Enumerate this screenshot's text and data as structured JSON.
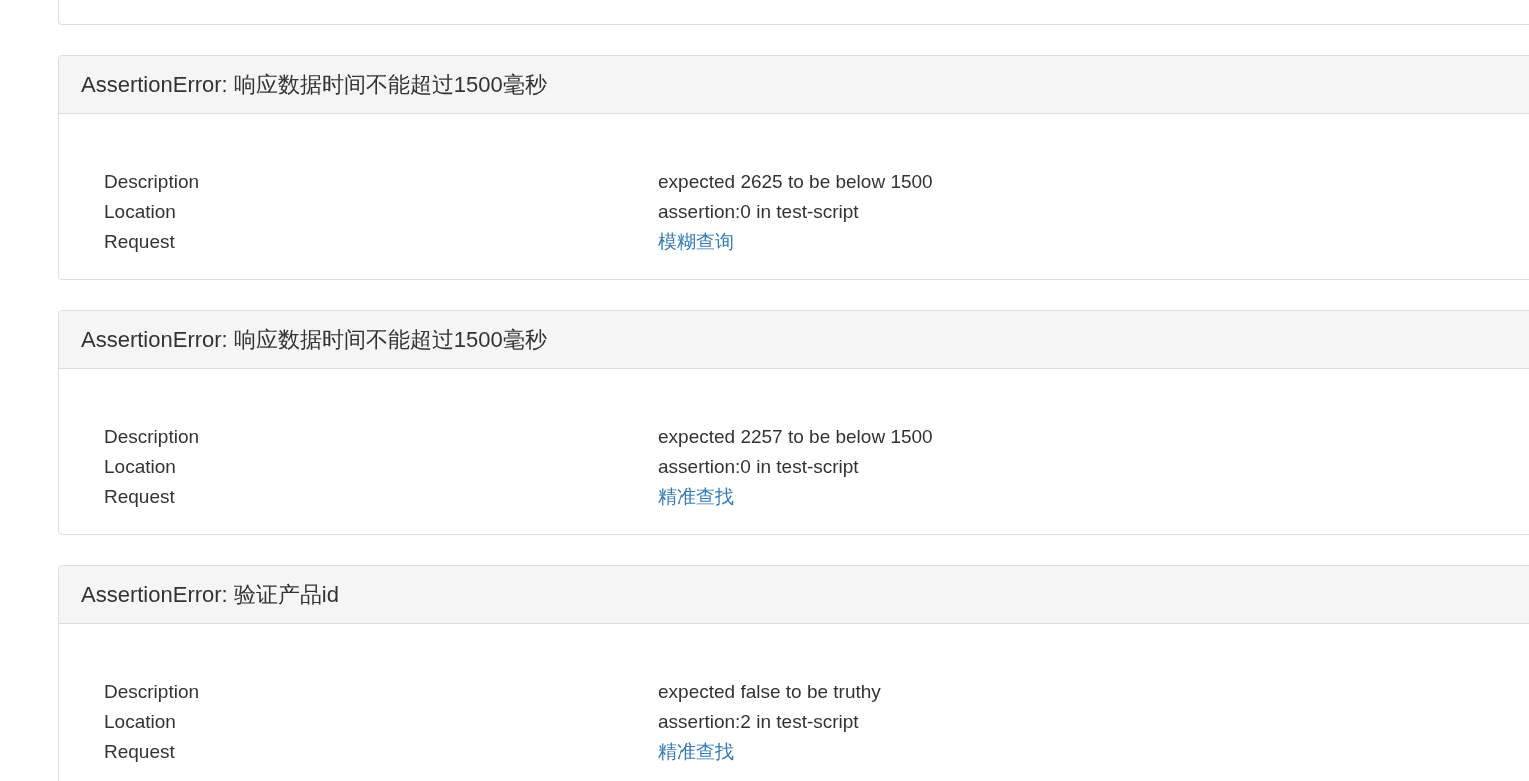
{
  "panels": [
    {
      "title": "AssertionError: 响应数据时间不能超过1500毫秒",
      "rows": [
        {
          "label": "Description",
          "value": "expected 2625 to be below 1500",
          "kind": "text"
        },
        {
          "label": "Location",
          "value": "assertion:0 in test-script",
          "kind": "text"
        },
        {
          "label": "Request",
          "value": "模糊查询",
          "kind": "link"
        }
      ]
    },
    {
      "title": "AssertionError: 响应数据时间不能超过1500毫秒",
      "rows": [
        {
          "label": "Description",
          "value": "expected 2257 to be below 1500",
          "kind": "text"
        },
        {
          "label": "Location",
          "value": "assertion:0 in test-script",
          "kind": "text"
        },
        {
          "label": "Request",
          "value": "精准查找",
          "kind": "link"
        }
      ]
    },
    {
      "title": "AssertionError: 验证产品id",
      "rows": [
        {
          "label": "Description",
          "value": "expected false to be truthy",
          "kind": "text"
        },
        {
          "label": "Location",
          "value": "assertion:2 in test-script",
          "kind": "text"
        },
        {
          "label": "Request",
          "value": "精准查找",
          "kind": "link"
        }
      ]
    }
  ]
}
